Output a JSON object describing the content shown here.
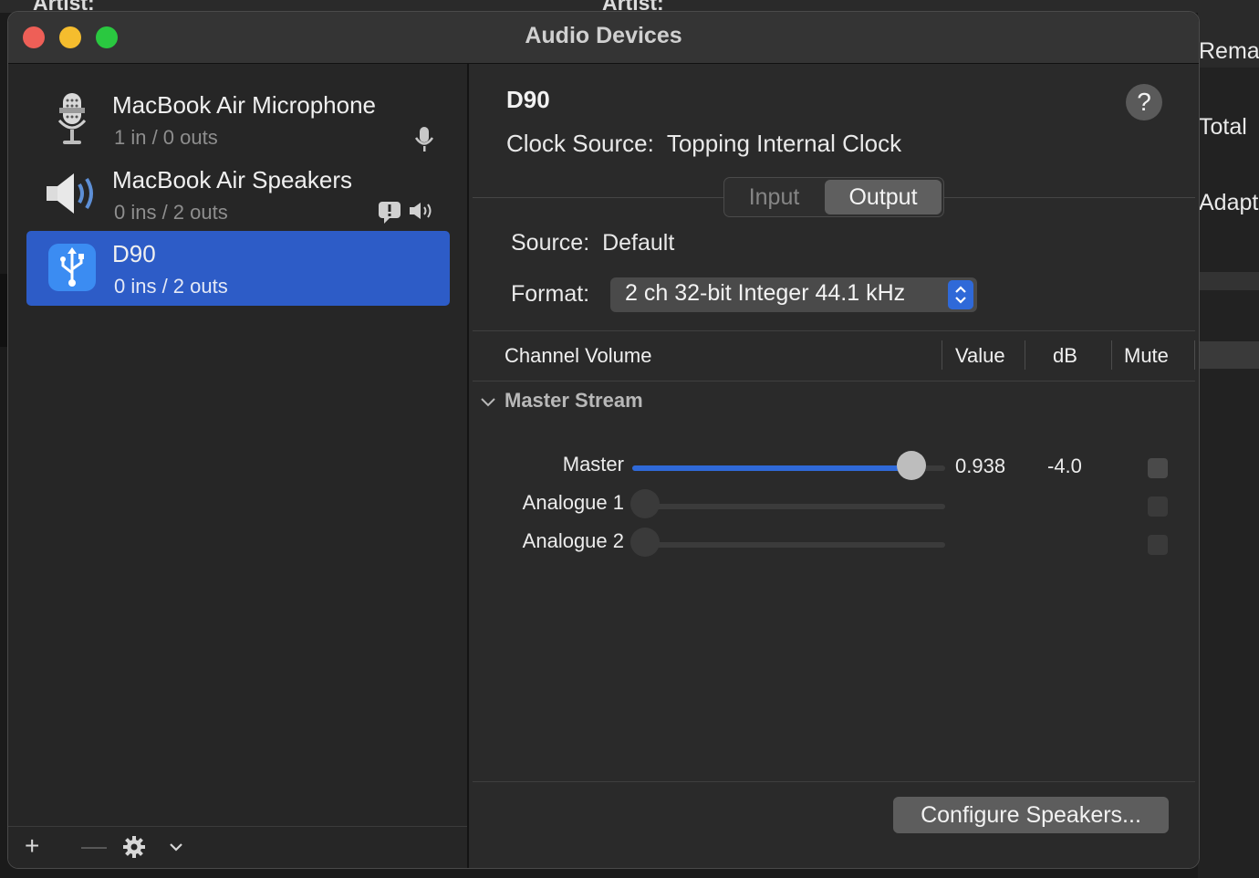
{
  "background": {
    "artist_label_left": "Artist:",
    "artist_label_right": "Artist:",
    "right_labels": [
      "Rema",
      "Total",
      "Adapt"
    ]
  },
  "window": {
    "title": "Audio Devices"
  },
  "sidebar": {
    "devices": [
      {
        "name": "MacBook Air Microphone",
        "subtitle": "1 in / 0 outs",
        "icon": "microphone-icon",
        "badge": "input-mic-icon"
      },
      {
        "name": "MacBook Air Speakers",
        "subtitle": "0 ins / 2 outs",
        "icon": "speaker-icon",
        "badge": "alert-speaker-icon"
      },
      {
        "name": "D90",
        "subtitle": "0 ins / 2 outs",
        "icon": "usb-icon",
        "selected": true
      }
    ],
    "footer": {
      "add": "+",
      "remove": "—",
      "settings": "gear-icon",
      "menu": "chevron-down-icon"
    }
  },
  "detail": {
    "device_name": "D90",
    "clock_label": "Clock Source:",
    "clock_value": "Topping Internal Clock",
    "help": "?",
    "tabs": {
      "input": "Input",
      "output": "Output",
      "selected": "Output"
    },
    "source_label": "Source:",
    "source_value": "Default",
    "format_label": "Format:",
    "format_value": "2 ch 32-bit Integer 44.1 kHz",
    "table": {
      "headers": {
        "channel": "Channel Volume",
        "value": "Value",
        "db": "dB",
        "mute": "Mute"
      },
      "group": "Master Stream",
      "rows": [
        {
          "label": "Master",
          "value": "0.938",
          "db": "-4.0",
          "level": 0.938,
          "enabled": true
        },
        {
          "label": "Analogue 1",
          "value": "",
          "db": "",
          "level": 0,
          "enabled": false
        },
        {
          "label": "Analogue 2",
          "value": "",
          "db": "",
          "level": 0,
          "enabled": false
        }
      ]
    },
    "configure_button": "Configure Speakers..."
  },
  "colors": {
    "accent": "#2f69d8",
    "selection": "#2d5cc7"
  }
}
